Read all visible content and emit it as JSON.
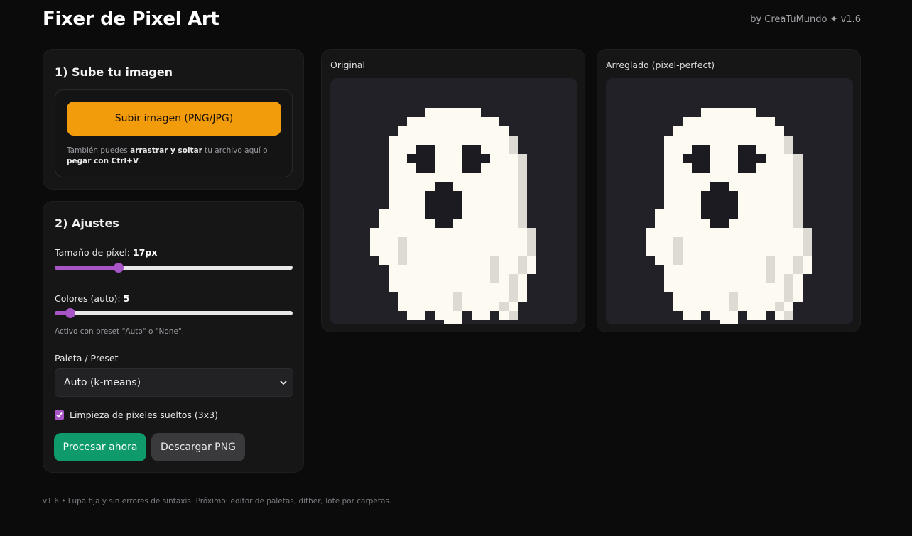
{
  "header": {
    "title": "Fixer de Pixel Art",
    "byline": "by CreaTuMundo ✦ v1.6"
  },
  "upload": {
    "heading": "1) Sube tu imagen",
    "button_label": "Subir imagen (PNG/JPG)",
    "hint": {
      "part1": "También puedes ",
      "bold1": "arrastrar y soltar",
      "part2": " tu archivo aquí o ",
      "bold2": "pegar con Ctrl+V",
      "part3": "."
    }
  },
  "settings": {
    "heading": "2) Ajustes",
    "pixel_size": {
      "label": "Tamaño de píxel: ",
      "value": "17px",
      "fraction": 0.27
    },
    "colors": {
      "label": "Colores (auto): ",
      "value": "5",
      "fraction": 0.065
    },
    "note": "Activo con preset \"Auto\" o \"None\".",
    "palette_label": "Paleta / Preset",
    "palette_selected": "Auto (k-means)",
    "cleanup_label": "Limpieza de píxeles sueltos (3x3)",
    "cleanup_checked": true,
    "process_label": "Procesar ahora",
    "download_label": "Descargar PNG"
  },
  "preview": {
    "original_label": "Original",
    "fixed_label": "Arreglado (pixel-perfect)"
  },
  "footer": "v1.6 • Lupa fija y sin errores de sintaxis. Próximo: editor de paletas, dither, lote por carpetas.",
  "colors": {
    "background": "#0b0b0c",
    "card": "#161617",
    "accent_orange": "#f39c0b",
    "accent_purple": "#a855c7",
    "accent_green": "#0f9a6c",
    "ghost_body": "#fdfaf1",
    "ghost_shade": "#dcdad3",
    "ghost_features": "#1d1b22",
    "canvas_bg": "#222128"
  },
  "icons": {
    "select_chevron": "chevron-down-icon",
    "checkbox": "check-icon",
    "ghost": "ghost-sprite"
  }
}
